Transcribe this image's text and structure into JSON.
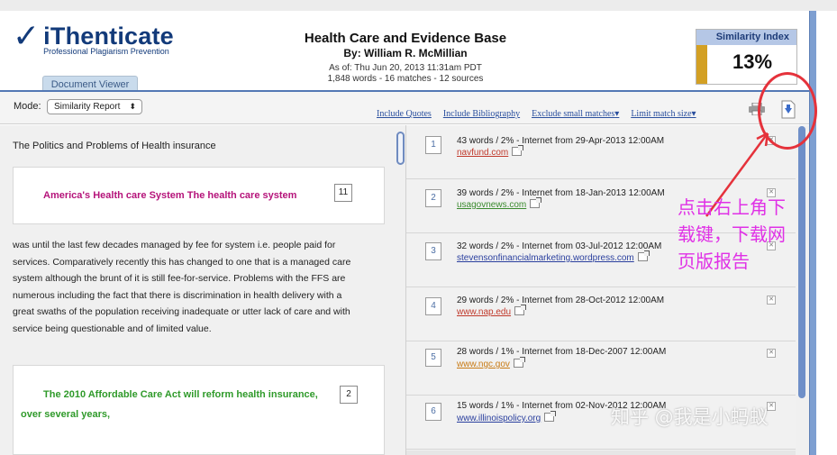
{
  "app": {
    "logo_name": "iThenticate",
    "logo_tagline": "Professional Plagiarism Prevention",
    "doc_viewer_button": "Document Viewer"
  },
  "document": {
    "title": "Health Care and Evidence Base",
    "author": "By: William R. McMillian",
    "as_of": "As of: Thu Jun 20, 2013 11:31am PDT",
    "stats": "1,848 words - 16 matches - 12 sources"
  },
  "similarity": {
    "label": "Similarity Index",
    "value": "13%",
    "accent_color": "#d3a024"
  },
  "toolbar": {
    "mode_label": "Mode:",
    "mode_value": "Similarity Report",
    "links": [
      "Include Quotes",
      "Include Bibliography",
      "Exclude small matches",
      "Limit match size"
    ],
    "print_icon": "printer-icon",
    "download_icon": "download-icon"
  },
  "report": {
    "section_title": "The Politics and Problems of Health insurance",
    "highlight1": {
      "text": "America's Health care System The health care system",
      "match": "11",
      "color": "#b5137a"
    },
    "body_lines": [
      "was until the last few decades managed by fee for system i.e. people paid for",
      "services. Comparatively recently this has changed to one that is a managed care",
      "system although the brunt of it is still fee-for-service. Problems with the FFS are",
      "numerous including the fact that there is discrimination in health delivery with a",
      "great swaths of the population receiving inadequate or utter lack of care and with",
      "service being questionable and of limited value."
    ],
    "highlight2": {
      "line1": "The 2010 Affordable Care Act will reform health insurance,",
      "line2": "over several years,",
      "match": "2",
      "color": "#2f9a2a"
    }
  },
  "sources": [
    {
      "num": "1",
      "desc": "43 words / 2% - Internet from 29-Apr-2013 12:00AM",
      "link": "navfund.com",
      "color": "#c0392b"
    },
    {
      "num": "2",
      "desc": "39 words / 2% - Internet from 18-Jan-2013 12:00AM",
      "link": "usagovnews.com",
      "color": "#3a8a2e"
    },
    {
      "num": "3",
      "desc": "32 words / 2% - Internet from 03-Jul-2012 12:00AM",
      "link": "stevensonfinancialmarketing.wordpress.com",
      "color": "#2a3f9e"
    },
    {
      "num": "4",
      "desc": "29 words / 2% - Internet from 28-Oct-2012 12:00AM",
      "link": "www.nap.edu",
      "color": "#c0392b"
    },
    {
      "num": "5",
      "desc": "28 words / 1% - Internet from 18-Dec-2007 12:00AM",
      "link": "www.ngc.gov",
      "color": "#c87a14"
    },
    {
      "num": "6",
      "desc": "15 words / 1% - Internet from 02-Nov-2012 12:00AM",
      "link": "www.illinoispolicy.org",
      "color": "#2a3f9e"
    }
  ],
  "annotation": {
    "lines": [
      "点击右上角下",
      "载键，下载网",
      "页版报告"
    ],
    "color": "#e031e6",
    "circle_color": "#e5323b"
  },
  "watermark": "知乎 @我是小蚂蚁"
}
